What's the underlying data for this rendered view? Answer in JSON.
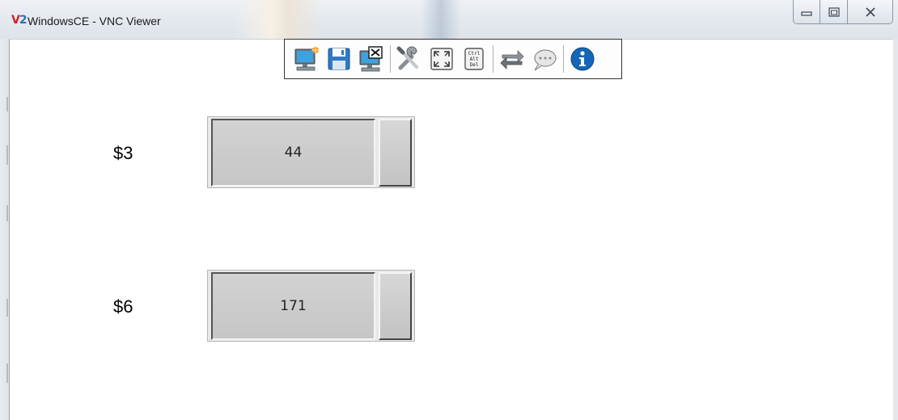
{
  "window": {
    "logo_v": "V",
    "logo_2": "2",
    "title": "WindowsCE - VNC Viewer",
    "controls": [
      "minimize-icon",
      "maximize-icon",
      "close-icon"
    ]
  },
  "toolbar": {
    "buttons": [
      "new-connection-icon",
      "save-icon",
      "disconnect-icon",
      "options-icon",
      "fullscreen-icon",
      "ctrl-alt-del-icon",
      "transfer-icon",
      "chat-icon",
      "info-icon"
    ],
    "ctrl_alt_del_text": [
      "Ctrl",
      "Alt",
      "Del"
    ]
  },
  "rows": [
    {
      "label": "$3",
      "value": "44"
    },
    {
      "label": "$6",
      "value": "171"
    }
  ],
  "colors": {
    "logo_v": "#d21f26",
    "logo_2": "#2b6fc2",
    "info": "#1467b8"
  }
}
